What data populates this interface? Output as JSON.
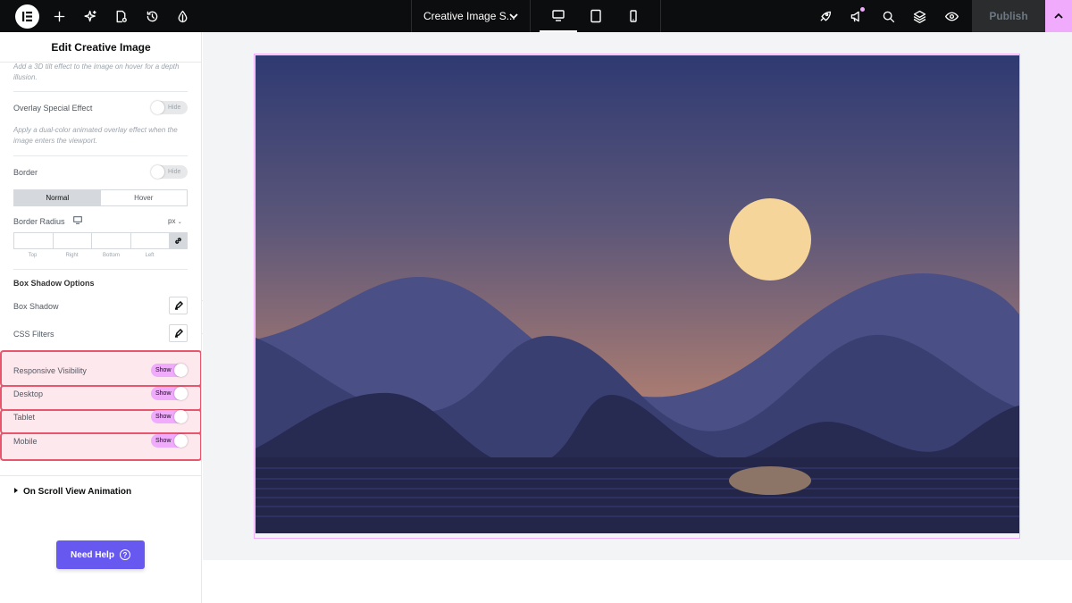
{
  "topbar": {
    "page_title": "Creative Image S...",
    "publish_label": "Publish",
    "icons": [
      "elementor-logo-icon",
      "add-icon",
      "ai-sparkle-icon",
      "page-settings-icon",
      "history-icon",
      "theme-style-icon",
      "rocket-icon",
      "announcements-icon",
      "search-icon",
      "layers-icon",
      "preview-eye-icon"
    ]
  },
  "panel": {
    "title": "Edit Creative Image",
    "tilt_desc": "Add a 3D tilt effect to the image on hover for a depth illusion.",
    "overlay_label": "Overlay Special Effect",
    "overlay_toggle": "Hide",
    "overlay_desc": "Apply a dual-color animated overlay effect when the image enters the viewport.",
    "border_label": "Border",
    "border_toggle": "Hide",
    "tab_normal": "Normal",
    "tab_hover": "Hover",
    "border_radius_label": "Border Radius",
    "unit": "px",
    "radius_labels": [
      "Top",
      "Right",
      "Bottom",
      "Left"
    ],
    "box_shadow_section": "Box Shadow Options",
    "box_shadow_label": "Box Shadow",
    "css_filters_label": "CSS Filters",
    "visibility": [
      {
        "label": "Responsive Visibility",
        "toggle": "Show"
      },
      {
        "label": "Desktop",
        "toggle": "Show"
      },
      {
        "label": "Tablet",
        "toggle": "Show"
      },
      {
        "label": "Mobile",
        "toggle": "Show"
      }
    ],
    "scroll_section": "On Scroll View Animation",
    "help_label": "Need Help",
    "help_icon": "?"
  },
  "colors": {
    "accent_pink": "#f0abfc",
    "highlight_red": "#e8566e",
    "help_purple": "#6758f0",
    "sky_top": "#2f3a72",
    "sky_bottom": "#c68767",
    "sun": "#f5d59a"
  }
}
